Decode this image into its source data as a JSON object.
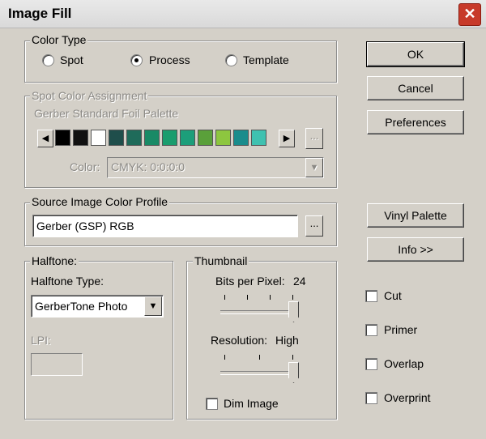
{
  "window": {
    "title": "Image Fill",
    "close_glyph": "✕"
  },
  "color_type": {
    "legend": "Color Type",
    "options": [
      {
        "label": "Spot",
        "selected": false
      },
      {
        "label": "Process",
        "selected": true
      },
      {
        "label": "Template",
        "selected": false
      }
    ]
  },
  "spot_color": {
    "legend": "Spot Color Assignment",
    "palette_label": "Gerber Standard Foil Palette",
    "swatches": [
      "#000000",
      "#111111",
      "#ffffff",
      "#1f4e4b",
      "#1f6b5a",
      "#198a66",
      "#1a9d6e",
      "#1c9e7a",
      "#5aa03a",
      "#8dc63f",
      "#1a8c8c",
      "#3fc1b0"
    ],
    "browse_label": "...",
    "color_label": "Color:",
    "color_value": "CMYK: 0:0:0:0",
    "scroll_left": "◀",
    "scroll_right": "▶"
  },
  "source_profile": {
    "legend": "Source Image Color Profile",
    "value": "Gerber (GSP) RGB",
    "browse_label": "..."
  },
  "halftone": {
    "legend": "Halftone:",
    "type_label": "Halftone Type:",
    "type_value": "GerberTone Photo",
    "lpi_label": "LPI:",
    "lpi_value": ""
  },
  "thumbnail": {
    "legend": "Thumbnail",
    "bpp_label": "Bits per Pixel:",
    "bpp_value": "24",
    "bpp_level": 1.0,
    "res_label": "Resolution:",
    "res_value": "High",
    "res_level": 1.0,
    "dim_label": "Dim Image",
    "dim_checked": false
  },
  "buttons": {
    "ok": "OK",
    "cancel": "Cancel",
    "preferences": "Preferences",
    "vinyl_palette": "Vinyl Palette",
    "info": "Info >>"
  },
  "options": {
    "cut": "Cut",
    "primer": "Primer",
    "overlap": "Overlap",
    "overprint": "Overprint"
  },
  "dropdown_arrow": "▼"
}
